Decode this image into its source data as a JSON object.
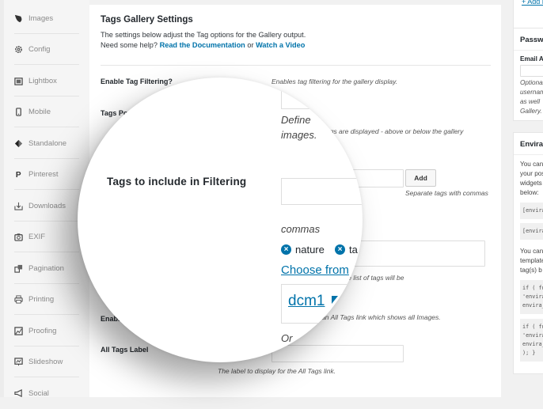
{
  "sidebar": {
    "items": [
      {
        "label": "Images",
        "icon": "leaf-icon"
      },
      {
        "label": "Config",
        "icon": "gear-icon"
      },
      {
        "label": "Lightbox",
        "icon": "lightbox-icon"
      },
      {
        "label": "Mobile",
        "icon": "mobile-icon"
      },
      {
        "label": "Standalone",
        "icon": "standalone-icon"
      },
      {
        "label": "Pinterest",
        "icon": "pinterest-icon"
      },
      {
        "label": "Downloads",
        "icon": "download-icon"
      },
      {
        "label": "EXIF",
        "icon": "camera-icon"
      },
      {
        "label": "Pagination",
        "icon": "pagination-icon"
      },
      {
        "label": "Printing",
        "icon": "printer-icon"
      },
      {
        "label": "Proofing",
        "icon": "proofing-icon"
      },
      {
        "label": "Slideshow",
        "icon": "slideshow-icon"
      },
      {
        "label": "Social",
        "icon": "megaphone-icon"
      }
    ]
  },
  "main": {
    "title": "Tags Gallery Settings",
    "description_line1": "The settings below adjust the Tag options for the Gallery output.",
    "help_prefix": "Need some help?",
    "doc_link": "Read the Documentation",
    "or_text": "or",
    "video_link": "Watch a Video",
    "fields": {
      "enable_filtering": {
        "label": "Enable Tag Filtering?",
        "help": "Enables tag filtering for the gallery display."
      },
      "tags_position": {
        "label": "Tags Position",
        "help": "Define where the tags are displayed - above or below the gallery images."
      },
      "tags_include": {
        "label": "Tags to include in Filtering",
        "add_button": "Add",
        "help": "Separate tags with commas",
        "tags": [
          "nature",
          "ta"
        ],
        "choose_link": "Choose from",
        "help2": "If none are set, the list of tags will be",
        "dcm": "dcm1"
      },
      "enable_all_tags": {
        "label": "Enable All Tags Link?",
        "help": "Enables an All Tags link which shows all Images."
      },
      "all_tags_label": {
        "label": "All Tags Label",
        "value": "",
        "help": "The label to display for the All Tags link."
      }
    },
    "magnified": {
      "label": "Tags to include in Filtering",
      "define": "Define",
      "images": "images.",
      "commas": "commas",
      "tags": [
        "nature",
        "ta"
      ],
      "choose_link": "Choose from",
      "dcm": "dcm1",
      "or": "Or"
    }
  },
  "right": {
    "add_link": "+ Add Ne",
    "password": {
      "title": "Password",
      "email_label": "Email Address",
      "help_lines": [
        "Optional",
        "username",
        "as well",
        "Gallery."
      ]
    },
    "envira": {
      "title": "Envira Tags",
      "text_lines": [
        "You can",
        "your post",
        "widgets",
        "below:"
      ],
      "shortcodes": [
        "[envira",
        "[envira"
      ],
      "text2_lines": [
        "You can",
        "template",
        "tag(s) b"
      ],
      "code1": [
        "if ( fu",
        "'envira",
        "envira_"
      ],
      "code2": [
        "if ( fu",
        "'envira",
        "envira_",
        "); }"
      ]
    }
  }
}
